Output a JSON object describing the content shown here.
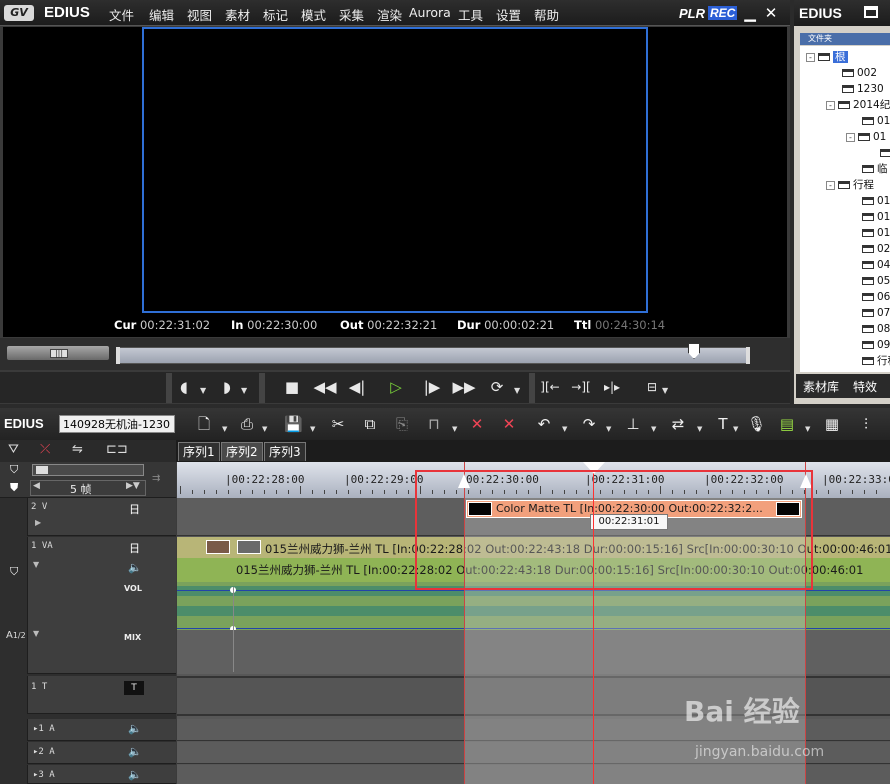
{
  "app": {
    "logo": "EDIUS",
    "badge": "GV"
  },
  "menu": [
    "文件",
    "编辑",
    "视图",
    "素材",
    "标记",
    "模式",
    "采集",
    "渲染",
    "Aurora",
    "工具",
    "设置",
    "帮助"
  ],
  "player": {
    "mode_plr": "PLR",
    "mode_rec": "REC",
    "timecodes": {
      "cur_label": "Cur",
      "cur": "00:22:31:02",
      "in_label": "In",
      "in": "00:22:30:00",
      "out_label": "Out",
      "out": "00:22:32:21",
      "dur_label": "Dur",
      "dur": "00:00:02:21",
      "ttl_label": "Ttl",
      "ttl": "00:24:30:14"
    },
    "slider_fraction": 0.904
  },
  "bin": {
    "logo": "EDIUS",
    "folder_header": "文件夹",
    "tree": [
      {
        "label": "根",
        "indent": 1,
        "selected": true,
        "expander": "⊟"
      },
      {
        "label": "002",
        "indent": 2
      },
      {
        "label": "1230",
        "indent": 2
      },
      {
        "label": "2014纪",
        "indent": 2,
        "expander": "⊟"
      },
      {
        "label": "01",
        "indent": 3
      },
      {
        "label": "01",
        "indent": 3,
        "expander": "⊟"
      },
      {
        "label": "",
        "indent": 4
      },
      {
        "label": "临",
        "indent": 3
      },
      {
        "label": "行程",
        "indent": 2,
        "expander": "⊟"
      },
      {
        "label": "01",
        "indent": 3
      },
      {
        "label": "01",
        "indent": 3
      },
      {
        "label": "01",
        "indent": 3
      },
      {
        "label": "02",
        "indent": 3
      },
      {
        "label": "04",
        "indent": 3
      },
      {
        "label": "05",
        "indent": 3
      },
      {
        "label": "06",
        "indent": 3
      },
      {
        "label": "07",
        "indent": 3
      },
      {
        "label": "08",
        "indent": 3
      },
      {
        "label": "09",
        "indent": 3
      },
      {
        "label": "行程",
        "indent": 3
      }
    ],
    "tabs": [
      "素材库",
      "特效"
    ]
  },
  "timeline": {
    "logo": "EDIUS",
    "sequence_name": "140928无机油-1230",
    "sequence_tabs": [
      "序列1",
      "序列2",
      "序列3"
    ],
    "zoom": "5 帧",
    "ruler_labels": [
      "|00:22:28:00",
      "|00:22:29:00",
      "00:22:30:00",
      "|00:22:31:00",
      "|00:22:32:00",
      "|00:22:33:00"
    ],
    "tracks": {
      "v2": "2 V",
      "va1": "1 VA",
      "a_vol": "VOL",
      "a_mix": "MIX",
      "t1": "1 T",
      "a1": "1 A",
      "a2": "2 A",
      "a3": "3 A",
      "a_side": "A",
      "a_side_num": "1/2"
    },
    "color_matte_clip": "Color Matte  TL [In:00:22:30:00  Out:00:22:32:2...",
    "tooltip": "00:22:31:01",
    "va_clip": "015兰州威力狮-兰州  TL [In:00:22:28:02  Out:00:22:43:18  Dur:00:00:15:16]  Src[In:00:00:30:10  Out:00:00:46:01",
    "audio_clip": "015兰州威力狮-兰州  TL [In:00:22:28:02  Out:00:22:43:18  Dur:00:00:15:16]  Src[In:00:00:30:10  Out:00:00:46:01"
  },
  "watermark": {
    "text": "Bai 经验",
    "url": "jingyan.baidu.com"
  },
  "colors": {
    "accent": "#2f6fd6",
    "highlight": "#e8343a",
    "matte": "#f2a07c"
  }
}
